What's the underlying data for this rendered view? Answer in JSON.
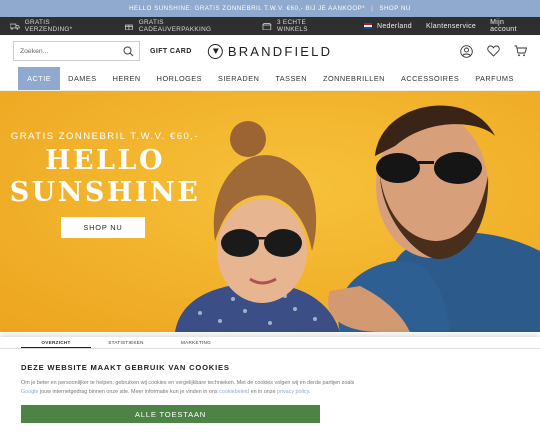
{
  "promo": {
    "text": "HELLO SUNSHINE: GRATIS ZONNEBRIL T.W.V. €60,- BIJ JE AANKOOP*",
    "sep": "|",
    "link": "SHOP NU"
  },
  "usp": {
    "items": [
      "GRATIS VERZENDING*",
      "GRATIS CADEAUVERPAKKING",
      "3 ECHTE WINKELS"
    ],
    "country": "Nederland",
    "service": "Klantenservice",
    "account": "Mijn account"
  },
  "header": {
    "search_placeholder": "Zoeken...",
    "giftcard": "GIFT CARD",
    "brand": "BRANDFIELD"
  },
  "nav": [
    "ACTIE",
    "DAMES",
    "HEREN",
    "HORLOGES",
    "SIERADEN",
    "TASSEN",
    "ZONNEBRILLEN",
    "ACCESSOIRES",
    "PARFUMS"
  ],
  "hero": {
    "subtitle": "GRATIS ZONNEBRIL T.W.V. €60,-",
    "title_line1": "HELLO",
    "title_line2": "SUNSHINE",
    "cta": "SHOP NU"
  },
  "cookie": {
    "tabs": [
      "OVERZICHT",
      "STATISTIEKEN",
      "MARKETING"
    ],
    "title": "DEZE WEBSITE MAAKT GEBRUIK VAN COOKIES",
    "text1": "Om je beter en persoonlijker te helpen, gebruiken wij cookies en vergelijkbare technieken. Met de cookies volgen wij en derde partijen zoals",
    "link_google": "Google",
    "text2": " jouw internetgedrag binnen onze site. Meer informatie kun je vinden in ons ",
    "link_cookiebeleid": "cookiebeleid",
    "text3": " en in onze ",
    "link_privacy": "privacy policy",
    "text4": ".",
    "accept": "ALLE TOESTAAN"
  },
  "colors": {
    "accent": "#8fa9cf",
    "accept_green": "#4d8446",
    "hero_yellow": "#f2b12a"
  }
}
